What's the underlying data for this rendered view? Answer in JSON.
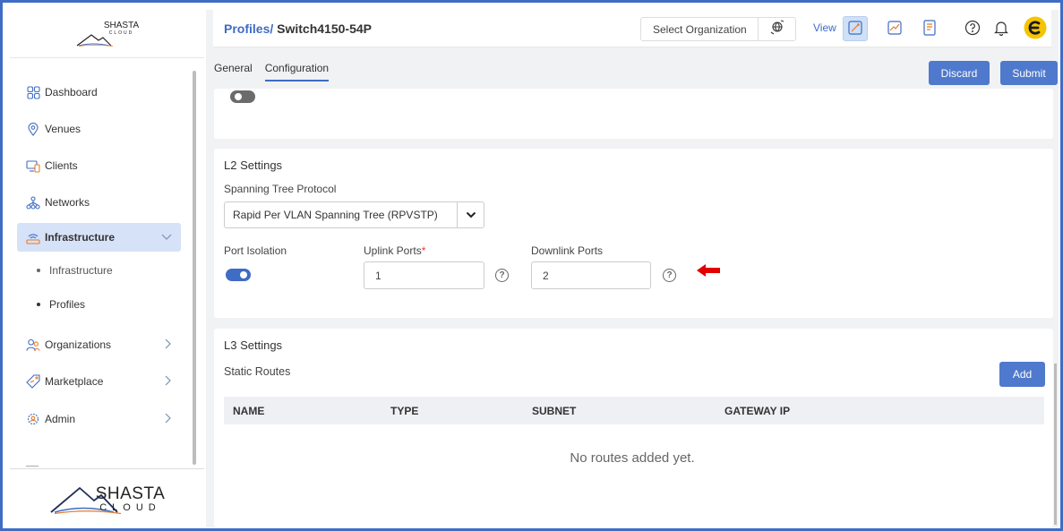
{
  "brand": {
    "logo_top": "SHASTA",
    "logo_sub": "CLOUD",
    "logo_bottom_main": "SHASTA",
    "logo_bottom_sub": "CLOUD"
  },
  "sidebar": {
    "items": [
      {
        "label": "Dashboard",
        "icon": "dashboard-icon"
      },
      {
        "label": "Venues",
        "icon": "location-pin-icon"
      },
      {
        "label": "Clients",
        "icon": "devices-icon"
      },
      {
        "label": "Networks",
        "icon": "network-icon"
      },
      {
        "label": "Infrastructure",
        "icon": "router-icon",
        "active": true,
        "expanded": true
      },
      {
        "label": "Organizations",
        "icon": "users-icon"
      },
      {
        "label": "Marketplace",
        "icon": "tag-icon"
      },
      {
        "label": "Admin",
        "icon": "admin-gear-icon"
      }
    ],
    "subitems": [
      {
        "label": "Infrastructure"
      },
      {
        "label": "Profiles"
      }
    ]
  },
  "header": {
    "crumb_parent": "Profiles/",
    "crumb_current": "Switch4150-54P",
    "org_select_label": "Select Organization",
    "view_label": "View"
  },
  "tabs": [
    {
      "label": "General"
    },
    {
      "label": "Configuration",
      "active": true
    }
  ],
  "actions": {
    "discard": "Discard",
    "submit": "Submit"
  },
  "l2": {
    "title": "L2 Settings",
    "stp_label": "Spanning Tree Protocol",
    "stp_value": "Rapid Per VLAN Spanning Tree (RPVSTP)",
    "port_isolation_label": "Port Isolation",
    "port_isolation_enabled": true,
    "uplink_label": "Uplink Ports",
    "uplink_required_mark": "*",
    "uplink_value": "1",
    "downlink_label": "Downlink Ports",
    "downlink_value": "2"
  },
  "l3": {
    "title": "L3 Settings",
    "routes_label": "Static Routes",
    "add_label": "Add",
    "columns": [
      "NAME",
      "TYPE",
      "SUBNET",
      "GATEWAY IP"
    ],
    "empty_text": "No routes added yet."
  },
  "colors": {
    "accent": "#3f6cc4",
    "button": "#4f79cc",
    "arrow": "#e00000"
  }
}
